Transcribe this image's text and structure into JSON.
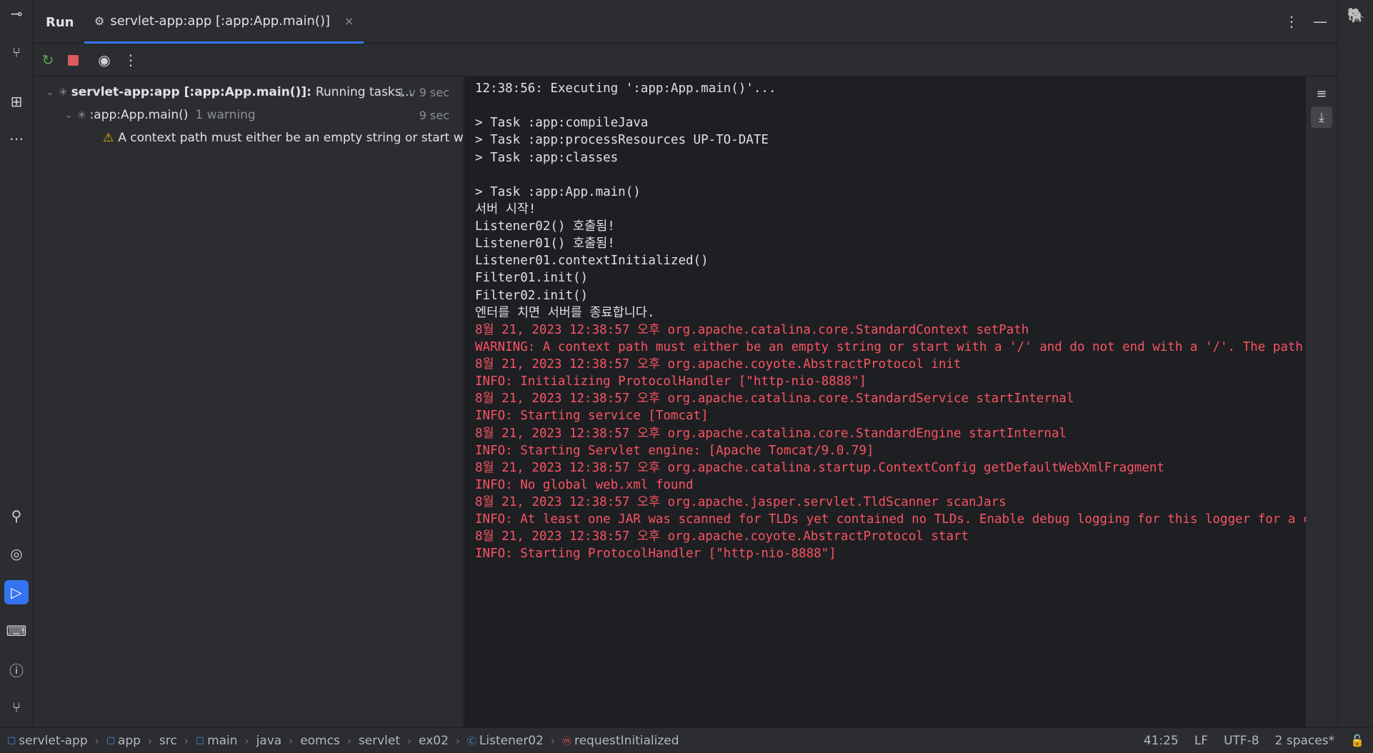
{
  "tabbar": {
    "run_label": "Run",
    "active_tab_label": "servlet-app:app [:app:App.main()]",
    "close_glyph": "×"
  },
  "tree": {
    "root": {
      "title": "servlet-app:app [:app:App.main()]:",
      "status": "Running tasks...",
      "time": "1 v 9 sec"
    },
    "child": {
      "title": ":app:App.main()",
      "badge": "1 warning",
      "time": "9 sec"
    },
    "warning": {
      "text": "A context path must either be an empty string or start with"
    }
  },
  "console": {
    "lines": [
      {
        "text": "12:38:56: Executing ':app:App.main()'...",
        "kind": "out"
      },
      {
        "text": "",
        "kind": "out"
      },
      {
        "text": "> Task :app:compileJava",
        "kind": "out"
      },
      {
        "text": "> Task :app:processResources UP-TO-DATE",
        "kind": "out"
      },
      {
        "text": "> Task :app:classes",
        "kind": "out"
      },
      {
        "text": "",
        "kind": "out"
      },
      {
        "text": "> Task :app:App.main()",
        "kind": "out"
      },
      {
        "text": "서버 시작!",
        "kind": "out"
      },
      {
        "text": "Listener02() 호출됨!",
        "kind": "out"
      },
      {
        "text": "Listener01() 호출됨!",
        "kind": "out"
      },
      {
        "text": "Listener01.contextInitialized()",
        "kind": "out"
      },
      {
        "text": "Filter01.init()",
        "kind": "out"
      },
      {
        "text": "Filter02.init()",
        "kind": "out"
      },
      {
        "text": "엔터를 치면 서버를 종료합니다.",
        "kind": "out"
      },
      {
        "text": "8월 21, 2023 12:38:57 오후 org.apache.catalina.core.StandardContext setPath",
        "kind": "err"
      },
      {
        "text": "WARNING: A context path must either be an empty string or start with a '/' and do not end with a '/'. The path [/] c",
        "kind": "err"
      },
      {
        "text": "8월 21, 2023 12:38:57 오후 org.apache.coyote.AbstractProtocol init",
        "kind": "err"
      },
      {
        "text": "INFO: Initializing ProtocolHandler [\"http-nio-8888\"]",
        "kind": "err"
      },
      {
        "text": "8월 21, 2023 12:38:57 오후 org.apache.catalina.core.StandardService startInternal",
        "kind": "err"
      },
      {
        "text": "INFO: Starting service [Tomcat]",
        "kind": "err"
      },
      {
        "text": "8월 21, 2023 12:38:57 오후 org.apache.catalina.core.StandardEngine startInternal",
        "kind": "err"
      },
      {
        "text": "INFO: Starting Servlet engine: [Apache Tomcat/9.0.79]",
        "kind": "err"
      },
      {
        "text": "8월 21, 2023 12:38:57 오후 org.apache.catalina.startup.ContextConfig getDefaultWebXmlFragment",
        "kind": "err"
      },
      {
        "text": "INFO: No global web.xml found",
        "kind": "err"
      },
      {
        "text": "8월 21, 2023 12:38:57 오후 org.apache.jasper.servlet.TldScanner scanJars",
        "kind": "err"
      },
      {
        "text": "INFO: At least one JAR was scanned for TLDs yet contained no TLDs. Enable debug logging for this logger for a comple",
        "kind": "err"
      },
      {
        "text": "8월 21, 2023 12:38:57 오후 org.apache.coyote.AbstractProtocol start",
        "kind": "err"
      },
      {
        "text": "INFO: Starting ProtocolHandler [\"http-nio-8888\"]",
        "kind": "err"
      }
    ]
  },
  "status": {
    "breadcrumb": [
      "servlet-app",
      "app",
      "src",
      "main",
      "java",
      "eomcs",
      "servlet",
      "ex02",
      "Listener02",
      "requestInitialized"
    ],
    "position": "41:25",
    "line_ending": "LF",
    "encoding": "UTF-8",
    "indent": "2 spaces*"
  },
  "colors": {
    "accent": "#3574f0",
    "error_text": "#f75464",
    "warning": "#e5b700",
    "console_bg": "#1e1f22",
    "panel_bg": "#2b2d30"
  },
  "icons": {
    "left_strip": [
      "commit-icon",
      "pull-requests-icon",
      "structure-icon",
      "more-icon",
      "search-icon",
      "services-icon",
      "run-icon",
      "terminal-icon",
      "problems-icon",
      "git-icon"
    ],
    "toolbar": [
      "rerun-icon",
      "stop-icon",
      "eye-icon",
      "more-options-icon"
    ],
    "console_side": [
      "soft-wrap-icon",
      "scroll-to-end-icon"
    ]
  }
}
